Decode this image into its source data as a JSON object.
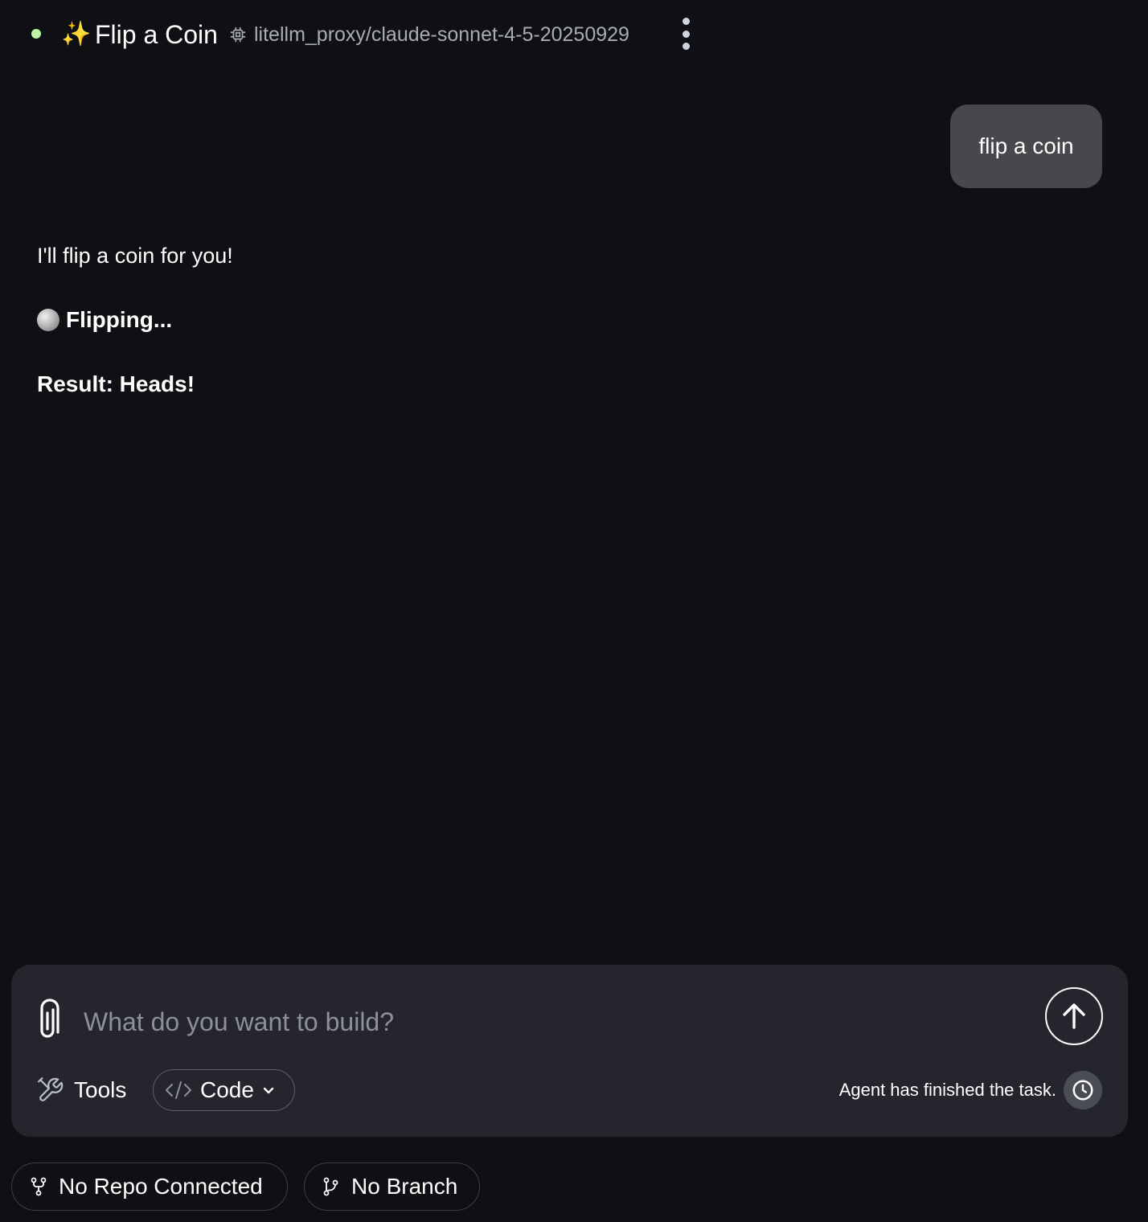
{
  "header": {
    "sparkle": "✨",
    "title": "Flip a Coin",
    "model": "litellm_proxy/claude-sonnet-4-5-20250929",
    "status_color": "#bdf7a6"
  },
  "conversation": {
    "user_message": "flip a coin",
    "assistant": {
      "line1": "I'll flip a coin for you!",
      "line2": "Flipping...",
      "line3": "Result: Heads!"
    }
  },
  "composer": {
    "placeholder": "What do you want to build?",
    "tools_label": "Tools",
    "mode_label": "Code",
    "agent_status": "Agent has finished the task."
  },
  "footer": {
    "repo_label": "No Repo Connected",
    "branch_label": "No Branch"
  },
  "icons": [
    "status-dot",
    "sparkle-icon",
    "chip-icon",
    "kebab-menu-icon",
    "coin-icon",
    "paperclip-icon",
    "arrow-up-icon",
    "tools-icon",
    "code-icon",
    "chevron-down-icon",
    "clock-icon",
    "repo-fork-icon",
    "git-branch-icon"
  ]
}
